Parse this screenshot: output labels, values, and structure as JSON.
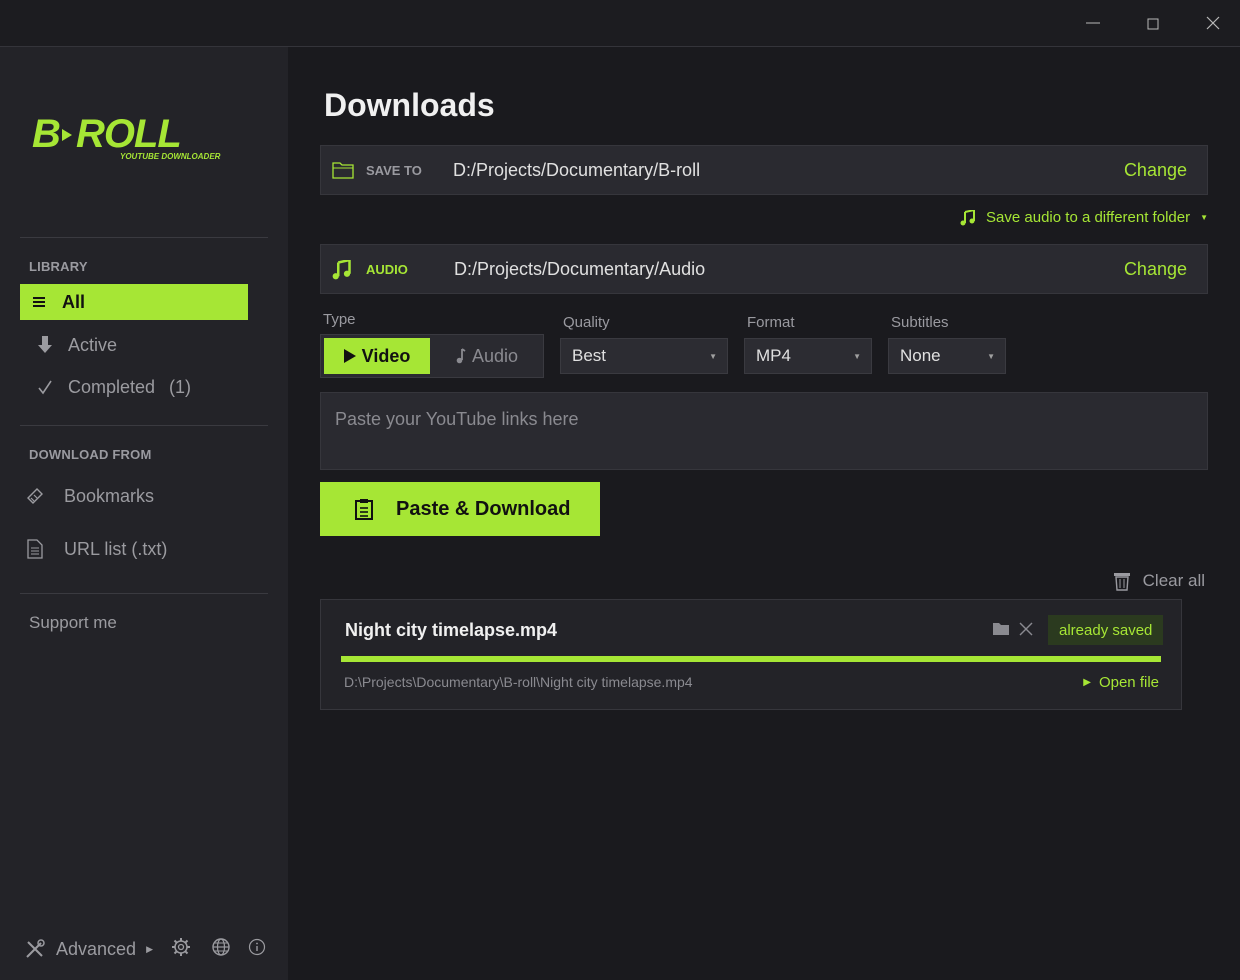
{
  "window": {
    "minimize_glyph": "—",
    "maximize_glyph": "☐",
    "close_glyph": "✕"
  },
  "sidebar": {
    "logo_text": "B·ROLL",
    "logo_subtitle": "YOUTUBE DOWNLOADER",
    "library_label": "LIBRARY",
    "library_items": [
      {
        "label": "All",
        "icon": "list-icon",
        "active": true
      },
      {
        "label": "Active",
        "icon": "download-arrow-icon",
        "active": false
      },
      {
        "label": "Completed",
        "count": "(1)",
        "icon": "check-icon",
        "active": false
      }
    ],
    "download_from_label": "DOWNLOAD FROM",
    "download_from_items": [
      {
        "label": "Bookmarks",
        "icon": "bookmark-icon"
      },
      {
        "label": "URL list (.txt)",
        "icon": "file-icon"
      }
    ],
    "support_label": "Support me",
    "advanced_label": "Advanced",
    "accent_color": "#a6e635"
  },
  "main": {
    "title": "Downloads",
    "save_to": {
      "label": "SAVE TO",
      "path": "D:/Projects/Documentary/B-roll",
      "change_label": "Change"
    },
    "audio_toggle_label": "Save audio to a different folder",
    "audio": {
      "label": "AUDIO",
      "path": "D:/Projects/Documentary/Audio",
      "change_label": "Change"
    },
    "type": {
      "label": "Type",
      "video_label": "Video",
      "audio_label": "Audio",
      "selected": "Video"
    },
    "quality": {
      "label": "Quality",
      "value": "Best"
    },
    "format": {
      "label": "Format",
      "value": "MP4"
    },
    "subtitles": {
      "label": "Subtitles",
      "value": "None"
    },
    "links_placeholder": "Paste your YouTube links here",
    "paste_button_label": "Paste & Download",
    "clear_all_label": "Clear all",
    "downloads": [
      {
        "name": "Night city timelapse.mp4",
        "badge": "already saved",
        "path": "D:\\Projects\\Documentary\\B-roll\\Night city timelapse.mp4",
        "progress": 1.0,
        "open_label": "Open file"
      }
    ]
  }
}
